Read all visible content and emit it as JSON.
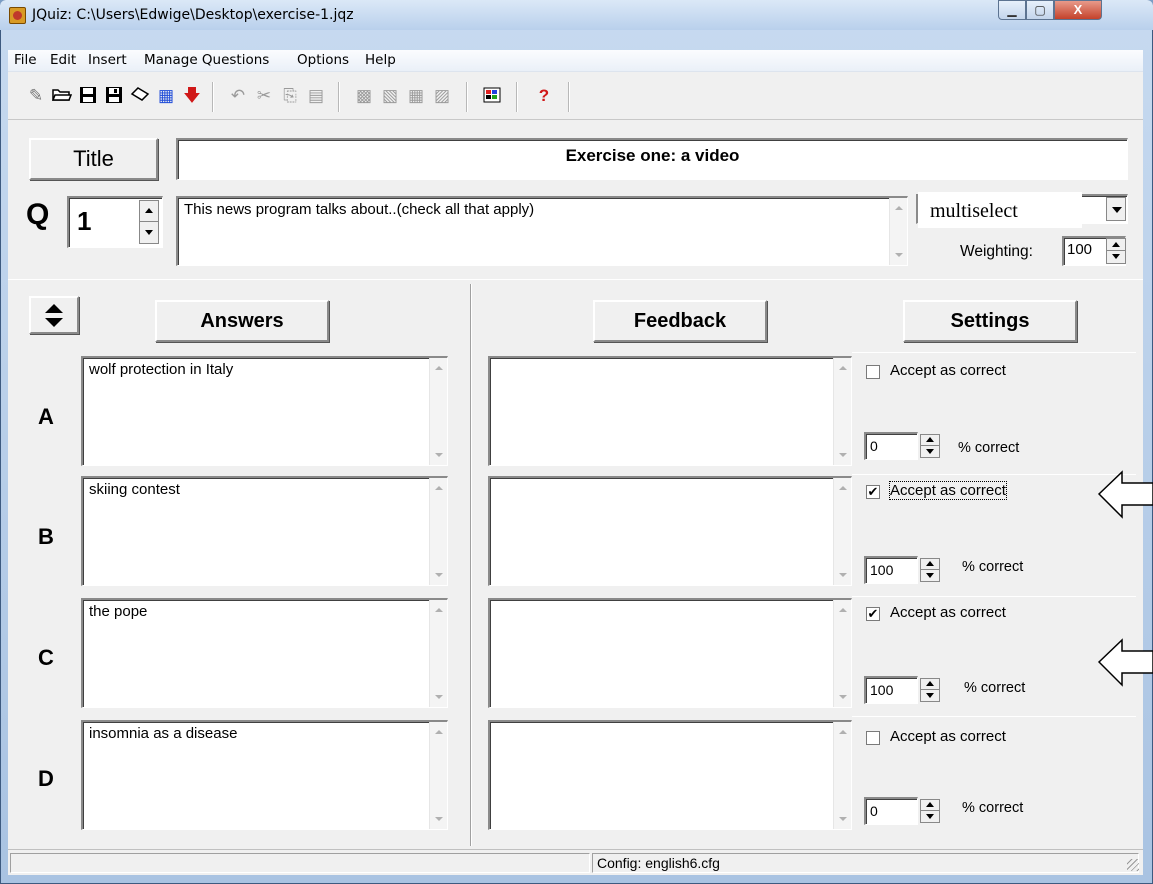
{
  "window": {
    "title": "JQuiz: C:\\Users\\Edwige\\Desktop\\exercise-1.jqz",
    "min_glyph": "▁",
    "max_glyph": "▢",
    "close_glyph": "X"
  },
  "menu": [
    "File",
    "Edit",
    "Insert",
    "Manage Questions",
    "Options",
    "Help"
  ],
  "toolbar": {
    "icons": [
      "new-file-icon",
      "open-folder-icon",
      "save-icon",
      "save-as-icon",
      "eraser-icon",
      "web-page-icon",
      "export-arrow-icon",
      "undo-icon",
      "cut-icon",
      "copy-icon",
      "paste-icon",
      "question-tool-1-icon",
      "question-tool-2-icon",
      "question-tool-3-icon",
      "question-tool-4-icon",
      "colors-icon",
      "help-icon"
    ]
  },
  "title_section": {
    "button_label": "Title",
    "value": "Exercise one: a video"
  },
  "question": {
    "q_label": "Q",
    "number": "1",
    "text": "This news program talks about..(check all that apply)",
    "type": "multiselect",
    "weighting_label": "Weighting:",
    "weighting": "100"
  },
  "columns": {
    "answers": "Answers",
    "feedback": "Feedback",
    "settings": "Settings"
  },
  "answers": [
    {
      "letter": "A",
      "text": "wolf protection in Italy",
      "feedback": "",
      "accept_label": "Accept as correct",
      "accepted": false,
      "check_glyph": "",
      "percent": "0",
      "percent_label": "% correct"
    },
    {
      "letter": "B",
      "text": "skiing contest",
      "feedback": "",
      "accept_label": "Accept as correct",
      "accepted": true,
      "check_glyph": "✔",
      "percent": "100",
      "percent_label": "% correct"
    },
    {
      "letter": "C",
      "text": "the pope",
      "feedback": "",
      "accept_label": "Accept as correct",
      "accepted": true,
      "check_glyph": "✔",
      "percent": "100",
      "percent_label": "% correct"
    },
    {
      "letter": "D",
      "text": "insomnia as a disease",
      "feedback": "",
      "accept_label": "Accept as correct",
      "accepted": false,
      "check_glyph": "",
      "percent": "0",
      "percent_label": "% correct"
    }
  ],
  "status": {
    "config": "Config: english6.cfg"
  },
  "colors": {
    "title_bar": "#c7daf0",
    "face": "#f0f0f0",
    "arrow_outline": "#000000"
  }
}
